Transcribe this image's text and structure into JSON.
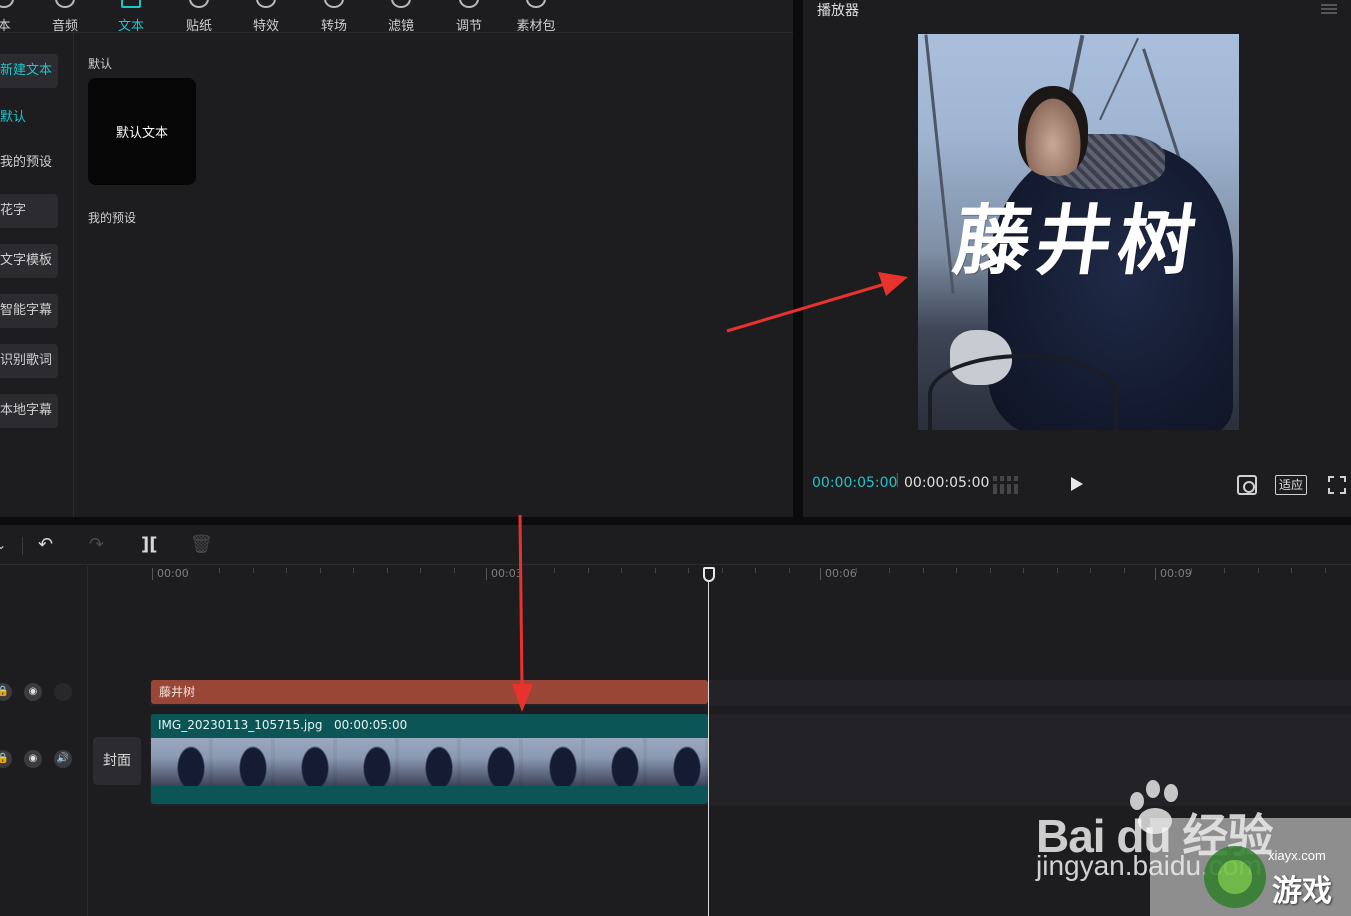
{
  "top_tabs": [
    {
      "label": "本",
      "icon": "media-icon"
    },
    {
      "label": "音频",
      "icon": "audio-icon"
    },
    {
      "label": "文本",
      "icon": "text-icon",
      "active": true
    },
    {
      "label": "贴纸",
      "icon": "sticker-icon"
    },
    {
      "label": "特效",
      "icon": "effects-icon"
    },
    {
      "label": "转场",
      "icon": "transition-icon"
    },
    {
      "label": "滤镜",
      "icon": "filter-icon"
    },
    {
      "label": "调节",
      "icon": "adjust-icon"
    },
    {
      "label": "素材包",
      "icon": "package-icon"
    }
  ],
  "side_nav": [
    {
      "label": "新建文本",
      "active": true,
      "boxed": true
    },
    {
      "label": "默认",
      "active": true,
      "boxed": false
    },
    {
      "label": "我的预设",
      "active": false,
      "boxed": false
    },
    {
      "label": "花字",
      "active": false,
      "boxed": true
    },
    {
      "label": "文字模板",
      "active": false,
      "boxed": true
    },
    {
      "label": "智能字幕",
      "active": false,
      "boxed": true
    },
    {
      "label": "识别歌词",
      "active": false,
      "boxed": true
    },
    {
      "label": "本地字幕",
      "active": false,
      "boxed": true
    }
  ],
  "content": {
    "default_section": "默认",
    "default_card": "默认文本",
    "my_preset_section": "我的预设"
  },
  "player": {
    "title": "播放器",
    "overlay_text": "藤井树",
    "time_current": "00:00:05:00",
    "time_total": "00:00:05:00",
    "ratio_label": "适应",
    "colors": {
      "accent": "#20c4cb"
    }
  },
  "timeline": {
    "ruler_labels": [
      "00:00",
      "00:03",
      "00:06",
      "00:09"
    ],
    "cover_label": "封面",
    "text_clip_label": "藤井树",
    "video_clip_name": "IMG_20230113_105715.jpg",
    "video_clip_duration": "00:00:05:00",
    "colors": {
      "text_clip": "#9a4636",
      "video_clip": "#0c5557"
    }
  },
  "watermark": {
    "baidu": "Bai du 经验",
    "jingyan": "jingyan.baidu.com",
    "site": "xiayx.com",
    "game": "游戏"
  }
}
